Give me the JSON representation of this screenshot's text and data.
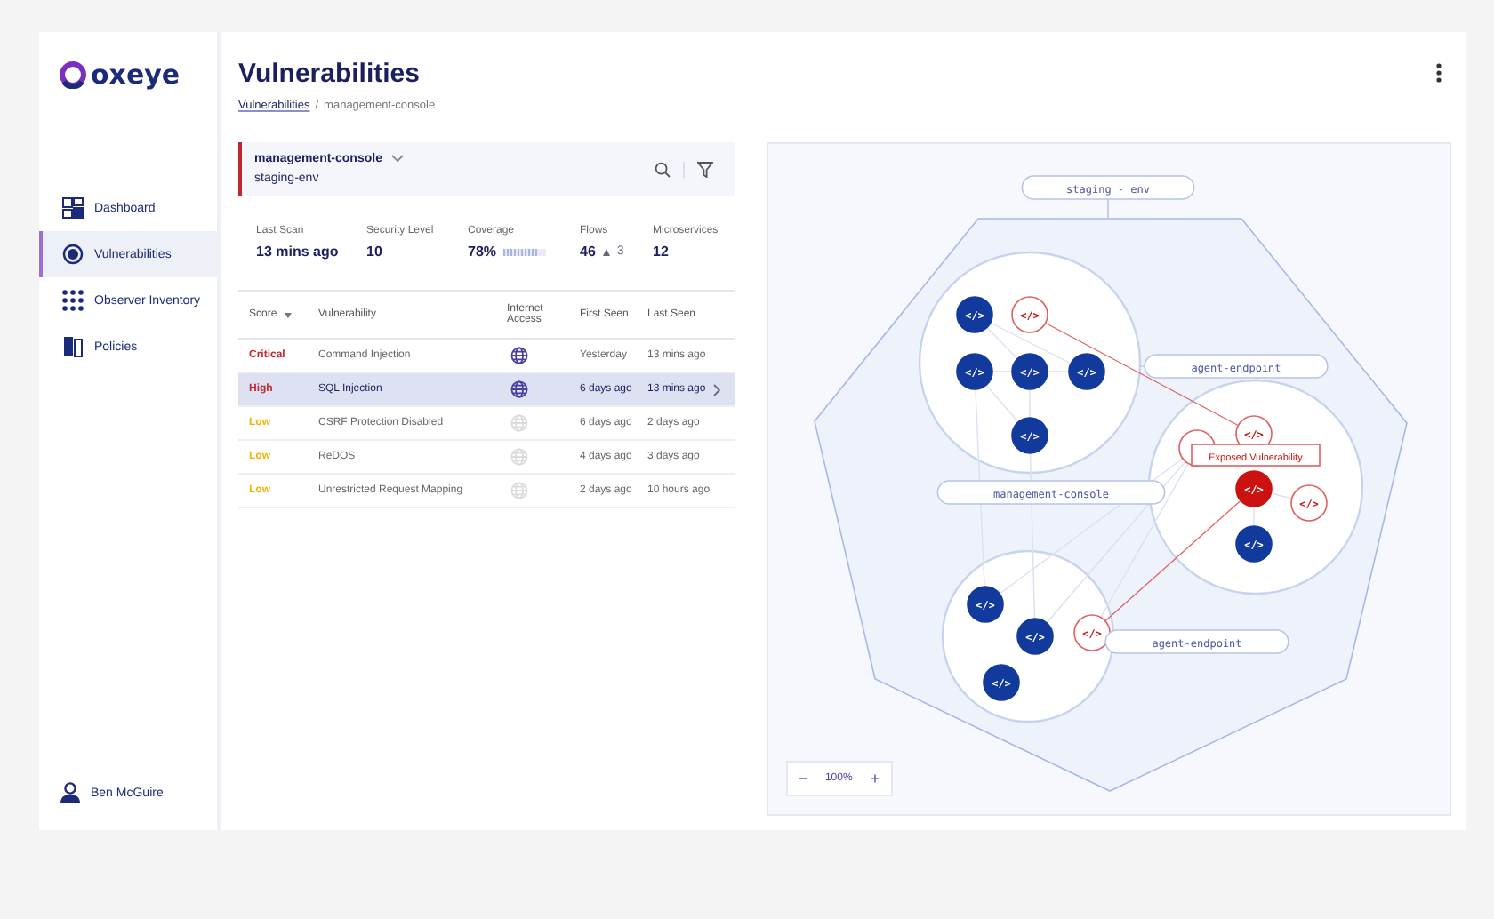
{
  "sidebar": {
    "logo": "oxeye",
    "items": [
      {
        "label": "Dashboard",
        "kind": "dashboard",
        "selected": false
      },
      {
        "label": "Vulnerabilities",
        "kind": "target",
        "selected": true
      },
      {
        "label": "Observer Inventory",
        "kind": "grid",
        "selected": false
      },
      {
        "label": "Policies",
        "kind": "doc",
        "selected": false
      }
    ],
    "user": "Ben McGuire"
  },
  "header": {
    "title": "Vulnerabilities",
    "breadcrumb": [
      {
        "label": "Vulnerabilities",
        "kind": "link"
      },
      {
        "label": "/",
        "kind": "separator"
      },
      {
        "label": "management-console",
        "kind": "current"
      }
    ]
  },
  "service": {
    "name": "management-console",
    "environment": "staging-env"
  },
  "stats": [
    {
      "label": "Last Scan",
      "value": "13 mins ago",
      "kind": "text"
    },
    {
      "label": "Security Level",
      "value": "10",
      "kind": "text"
    },
    {
      "label": "Coverage",
      "value": "78%",
      "kind": "meter",
      "level": 0.78
    },
    {
      "label": "Flows",
      "value": "46",
      "kind": "delta",
      "delta": "3"
    },
    {
      "label": "Microservices",
      "value": "12",
      "kind": "text"
    }
  ],
  "table": {
    "columns": [
      "Score",
      "Vulnerability",
      "Internet Access",
      "First Seen",
      "Last Seen"
    ],
    "rows": [
      {
        "score": "Critical",
        "kind": "critical",
        "vulnerability": "Command Injection",
        "internet_access": true,
        "first_seen": "Yesterday",
        "last_seen": "13 mins ago",
        "selected": false
      },
      {
        "score": "High",
        "kind": "high",
        "vulnerability": "SQL Injection",
        "internet_access": true,
        "first_seen": "6 days ago",
        "last_seen": "13 mins ago",
        "selected": true
      },
      {
        "score": "Low",
        "kind": "low",
        "vulnerability": "CSRF Protection Disabled",
        "internet_access": false,
        "first_seen": "6 days ago",
        "last_seen": "2 days ago",
        "selected": false
      },
      {
        "score": "Low",
        "kind": "low",
        "vulnerability": "ReDOS",
        "internet_access": false,
        "first_seen": "4 days ago",
        "last_seen": "3 days ago",
        "selected": false
      },
      {
        "score": "Low",
        "kind": "low",
        "vulnerability": "Unrestricted Request Mapping",
        "internet_access": false,
        "first_seen": "2 days ago",
        "last_seen": "10 hours ago",
        "selected": false
      }
    ]
  },
  "graph": {
    "environment": "staging - env",
    "clusters": [
      {
        "label": "agent-endpoint",
        "nodes": [
          {
            "kind": "normal",
            "glyph": "</>"
          },
          {
            "kind": "vulnerable",
            "glyph": "</>"
          },
          {
            "kind": "normal",
            "glyph": "</>"
          },
          {
            "kind": "normal",
            "glyph": "</>"
          },
          {
            "kind": "normal",
            "glyph": "</>"
          },
          {
            "kind": "normal",
            "glyph": "</>"
          }
        ]
      },
      {
        "label": "management-console",
        "nodes": [
          {
            "kind": "vulnerable"
          },
          {
            "kind": "vulnerable",
            "glyph": "</>"
          },
          {
            "kind": "exposed",
            "glyph": "</>"
          },
          {
            "kind": "vulnerable",
            "glyph": "</>"
          },
          {
            "kind": "normal",
            "glyph": "</>"
          }
        ]
      },
      {
        "label": "agent-endpoint",
        "nodes": [
          {
            "kind": "normal",
            "glyph": "</>"
          },
          {
            "kind": "normal",
            "glyph": "</>"
          },
          {
            "kind": "vulnerable",
            "glyph": "</>"
          },
          {
            "kind": "normal",
            "glyph": "</>"
          }
        ]
      }
    ],
    "tooltip": "Exposed Vulnerability",
    "zoom": {
      "minus": "−",
      "value": "100%",
      "plus": "+"
    }
  }
}
